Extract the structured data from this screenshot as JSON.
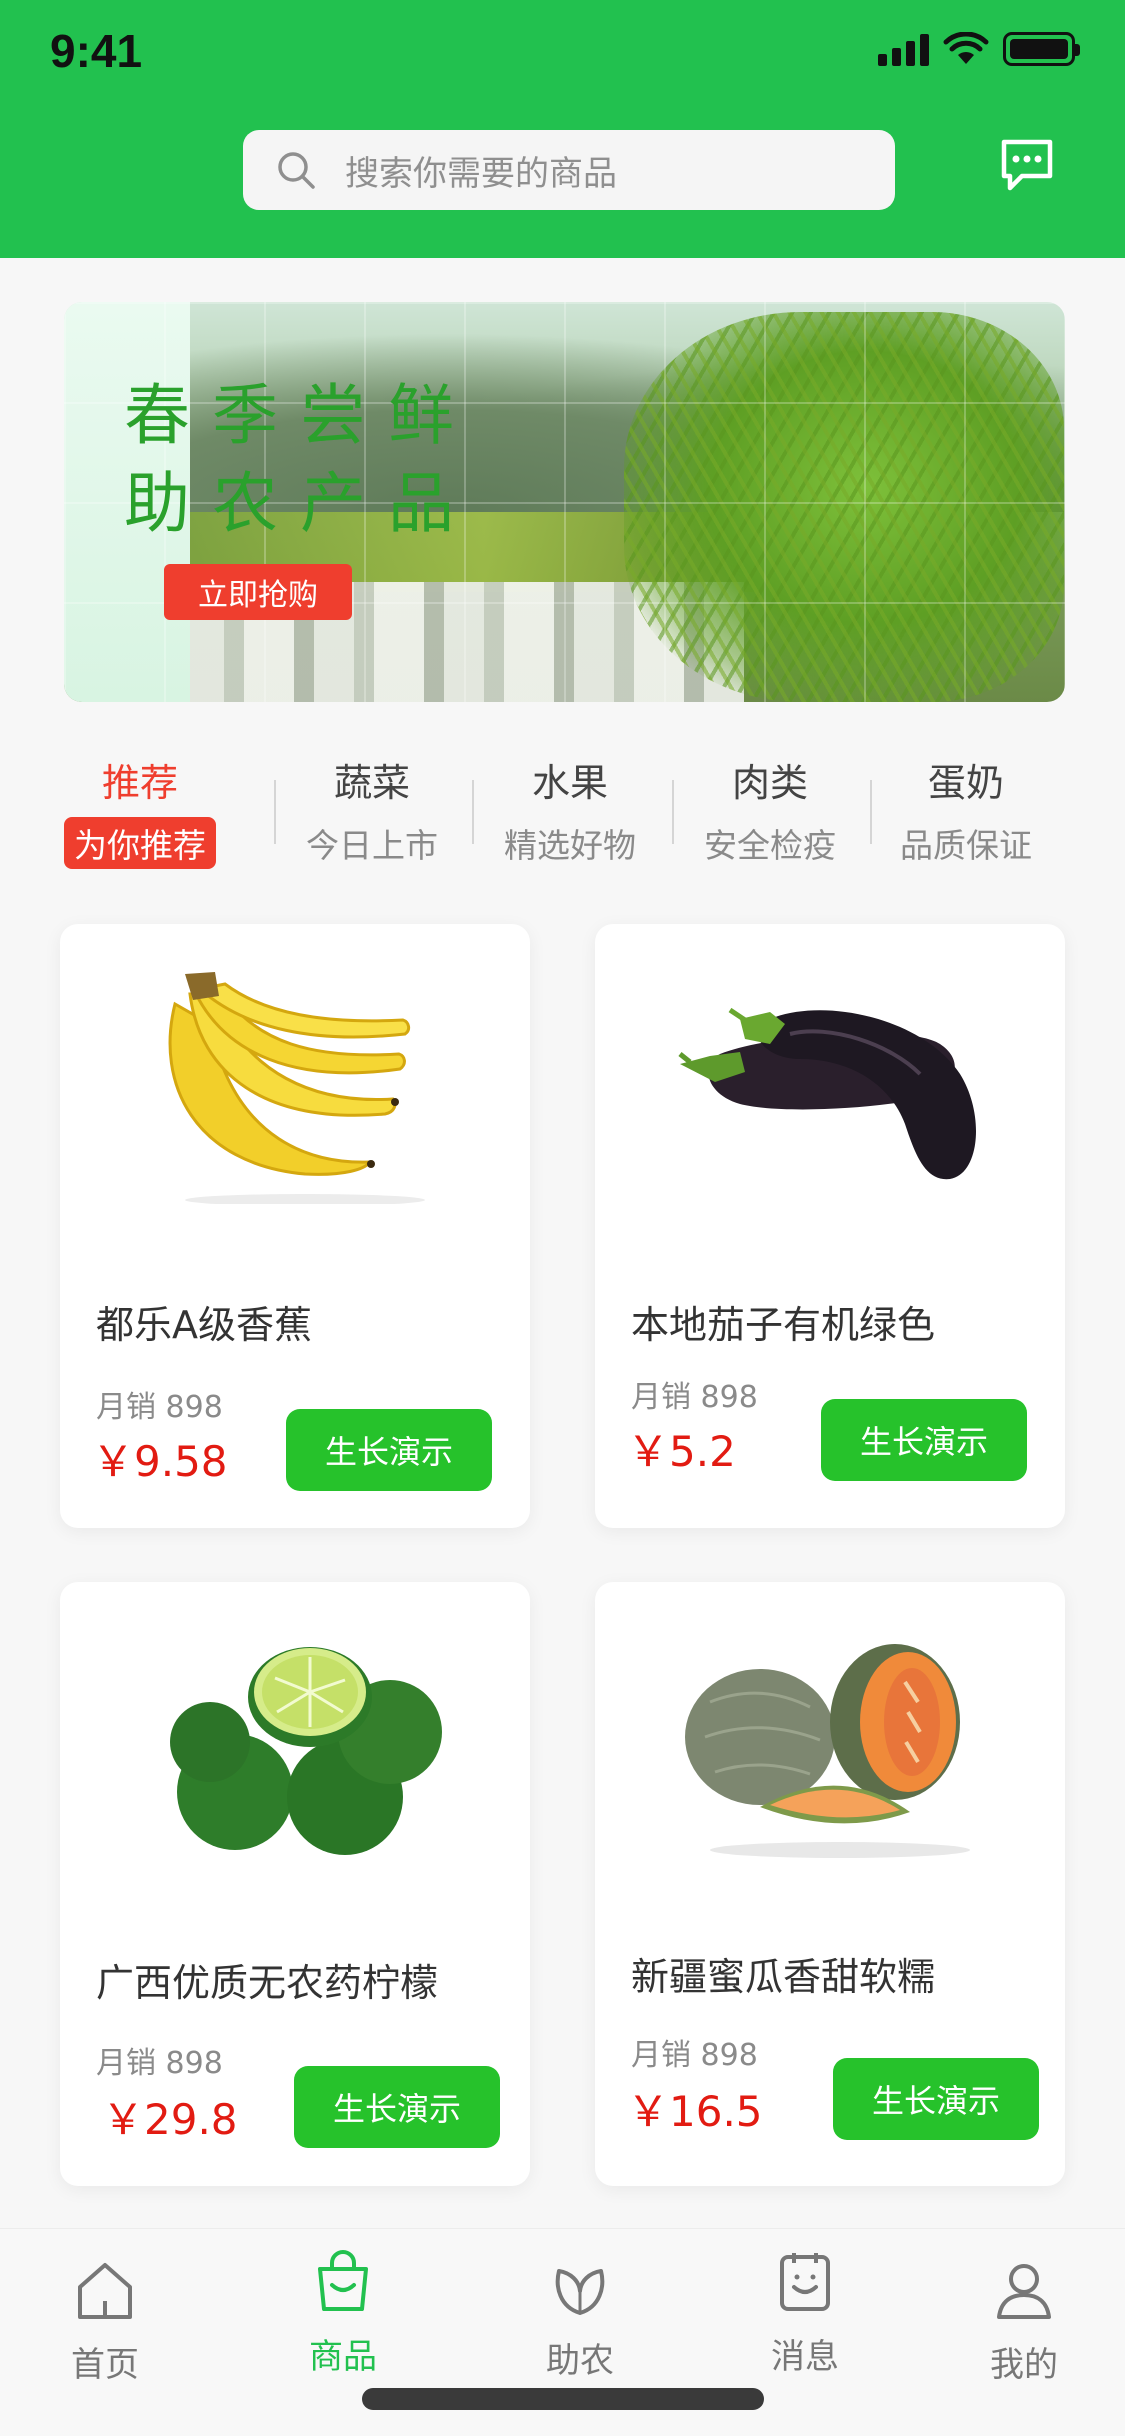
{
  "status_bar": {
    "time": "9:41"
  },
  "search": {
    "placeholder": "搜索你需要的商品"
  },
  "banner": {
    "line1": "春季尝鲜",
    "line2": "助农产品",
    "button": "立即抢购"
  },
  "categories": [
    {
      "title": "推荐",
      "subtitle": "为你推荐",
      "active": true
    },
    {
      "title": "蔬菜",
      "subtitle": "今日上市"
    },
    {
      "title": "水果",
      "subtitle": "精选好物"
    },
    {
      "title": "肉类",
      "subtitle": "安全检疫"
    },
    {
      "title": "蛋奶",
      "subtitle": "品质保证"
    }
  ],
  "products": [
    {
      "name": "都乐A级香蕉",
      "sales": "月销 898",
      "price": "￥9.58",
      "button": "生长演示",
      "image": "banana-image"
    },
    {
      "name": "本地茄子有机绿色",
      "sales": "月销 898",
      "price": "￥5.2",
      "button": "生长演示",
      "image": "eggplant-image"
    },
    {
      "name": "广西优质无农药柠檬",
      "sales": "月销  898",
      "price": "￥29.8",
      "button": "生长演示",
      "image": "lime-image"
    },
    {
      "name": "新疆蜜瓜香甜软糯",
      "sales": "月销  898",
      "price": "￥16.5",
      "button": "生长演示",
      "image": "melon-image"
    }
  ],
  "bottom_nav": [
    {
      "label": "首页",
      "icon": "home-icon"
    },
    {
      "label": "商品",
      "icon": "shopping-bag-icon",
      "active": true
    },
    {
      "label": "助农",
      "icon": "leaf-icon"
    },
    {
      "label": "消息",
      "icon": "message-icon"
    },
    {
      "label": "我的",
      "icon": "user-icon"
    }
  ],
  "colors": {
    "brand_green": "#22c14f",
    "button_green": "#26c22b",
    "accent_red": "#ef3e2e",
    "price_red": "#e21b12"
  }
}
